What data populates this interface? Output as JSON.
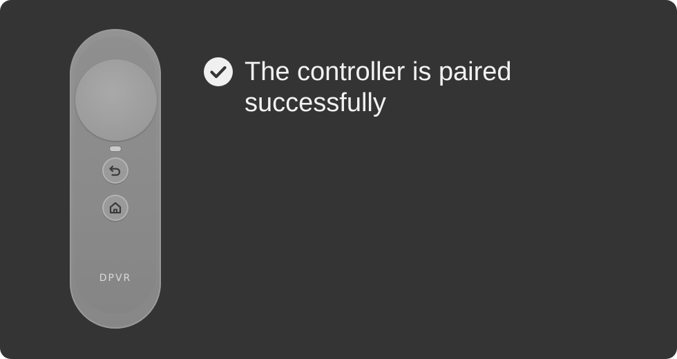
{
  "dialog": {
    "message": "The controller is paired successfully",
    "status_icon": "check-circle-icon"
  },
  "controller": {
    "brand": "DPVR",
    "icons": [
      "back-arrow-icon",
      "home-icon"
    ]
  },
  "colors": {
    "background": "#343434",
    "text": "#f2f2f2",
    "check_circle": "#f0f0f0",
    "check_mark": "#343434"
  }
}
